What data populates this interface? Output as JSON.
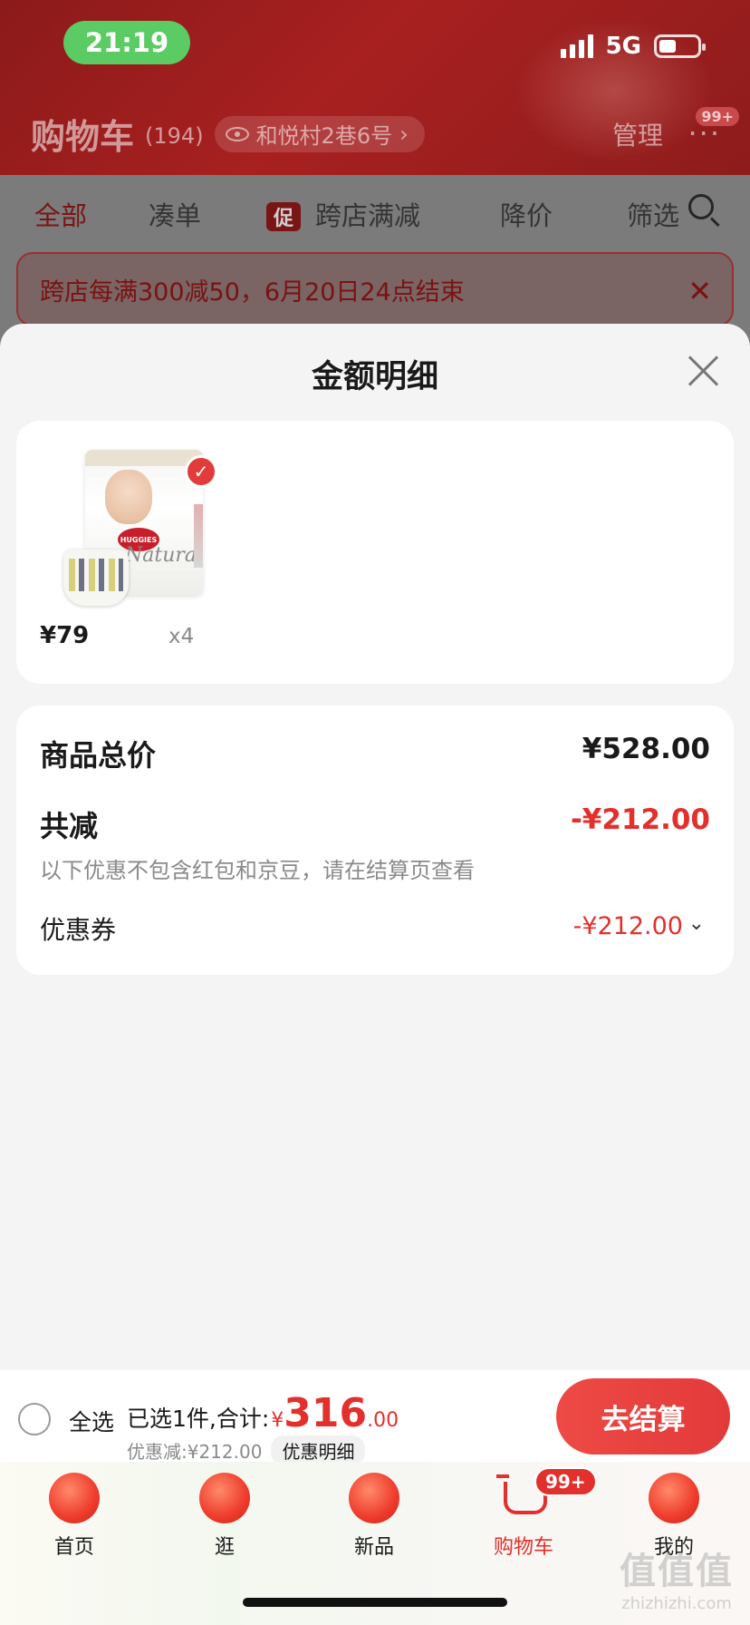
{
  "status_bar": {
    "time": "21:19",
    "network": "5G"
  },
  "header": {
    "title": "购物车",
    "count": "(194)",
    "address": "和悦村2巷6号",
    "manage": "管理",
    "more_badge": "99+"
  },
  "tabs": [
    {
      "label": "全部"
    },
    {
      "label": "凑单"
    },
    {
      "label": "跨店满减",
      "tag": "促"
    },
    {
      "label": "降价"
    },
    {
      "label": "筛选"
    }
  ],
  "promo_banner": {
    "text": "跨店每满300减50，6月20日24点结束"
  },
  "sheet": {
    "title": "金额明细",
    "item": {
      "price": "¥79",
      "qty": "x4",
      "logo": "HUGGIES",
      "script": "Natural"
    },
    "summary": {
      "total_label": "商品总价",
      "total_value": "¥528.00",
      "reduce_label": "共减",
      "reduce_value": "-¥212.00",
      "note": "以下优惠不包含红包和京豆，请在结算页查看",
      "coupon_label": "优惠券",
      "coupon_value": "-¥212.00"
    }
  },
  "checkout": {
    "select_all": "全选",
    "selected_text": "已选1件,合计:",
    "currency": "¥",
    "total_int": "316",
    "total_dec": ".00",
    "discount_text": "优惠减:¥212.00",
    "detail_label": "优惠明细",
    "button": "去结算"
  },
  "bottom_nav": [
    {
      "label": "首页",
      "icon": "home-icon"
    },
    {
      "label": "逛",
      "icon": "browse-icon"
    },
    {
      "label": "新品",
      "icon": "new-products-icon"
    },
    {
      "label": "购物车",
      "icon": "cart-icon",
      "badge": "99+",
      "active": true
    },
    {
      "label": "我的",
      "icon": "profile-icon"
    }
  ],
  "watermark": {
    "line1": "值值值",
    "line2": "zhizhizhi.com"
  },
  "colors": {
    "accent": "#e2302c",
    "header_bg": "#8c1a1a",
    "checkout_button": "#ee4a45"
  }
}
